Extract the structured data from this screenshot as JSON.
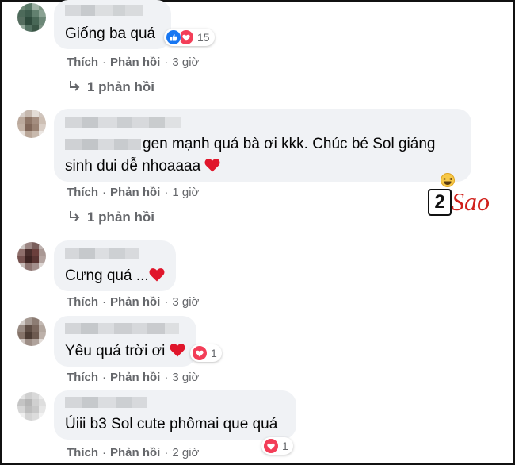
{
  "colors": {
    "bubble": "#f0f2f5",
    "meta": "#65676b",
    "like": "#1877f2",
    "love": "#f33e58",
    "logo": "#d0201b"
  },
  "actions": {
    "like": "Thích",
    "reply": "Phản hồi",
    "separator": "·"
  },
  "comments": [
    {
      "text": "Giống ba quá",
      "time": "3 giờ",
      "reactions": [
        "like-icon",
        "love-icon"
      ],
      "reaction_count": "15",
      "replies": "1 phản hồi"
    },
    {
      "text_line1": "gen mạnh quá bà ơi kkk. Chúc bé Sol giáng",
      "text_line2": "sinh dui dễ nhoaaaa",
      "time": "1 giờ",
      "reactions": [
        "haha-icon"
      ],
      "replies": "1 phản hồi"
    },
    {
      "text": "Cưng quá ...",
      "time": "3 giờ"
    },
    {
      "text": "Yêu quá trời ơi",
      "time": "3 giờ",
      "reactions": [
        "love-icon"
      ],
      "reaction_count": "1"
    },
    {
      "text": "Úiii b3 Sol cute phômai que quá",
      "time": "2 giờ",
      "reactions": [
        "love-icon"
      ],
      "reaction_count": "1"
    }
  ],
  "watermark": {
    "number": "2",
    "word": "Sao"
  }
}
